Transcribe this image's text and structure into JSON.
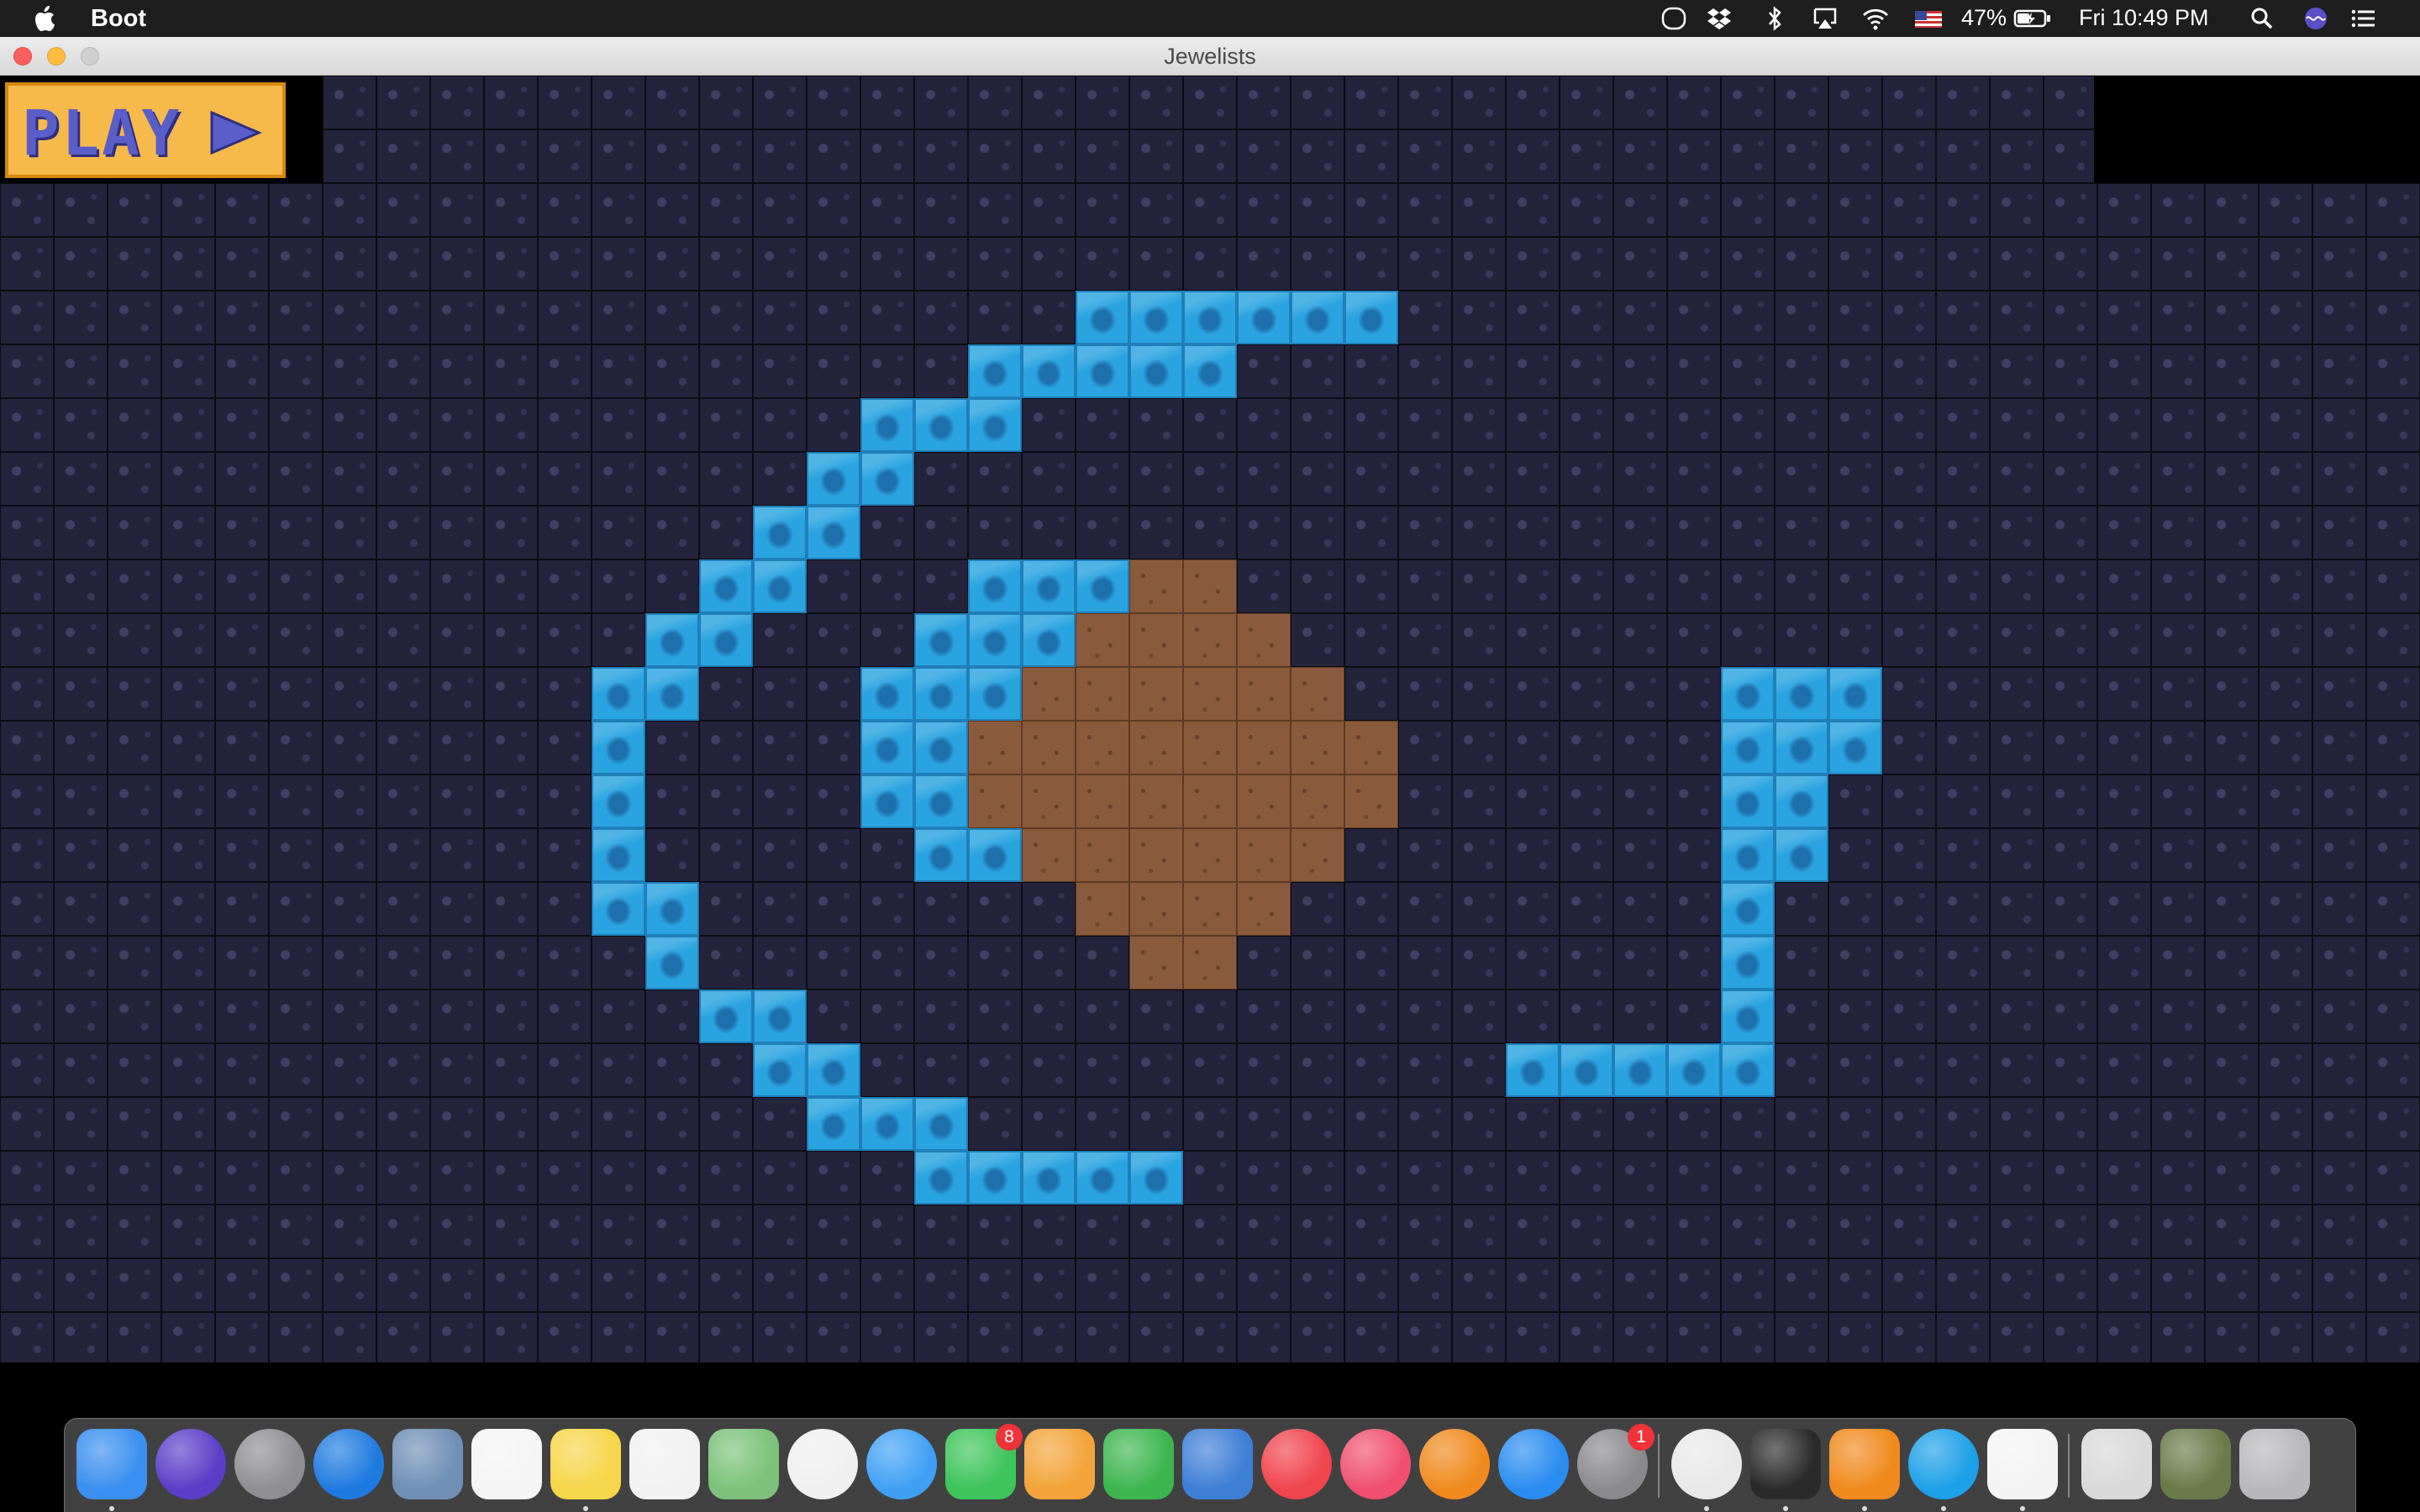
{
  "menubar": {
    "app_name": "Boot",
    "battery": "47%",
    "clock": "Fri 10:49 PM"
  },
  "window": {
    "title": "Jewelists"
  },
  "game": {
    "play_label": "PLAY",
    "water_tiles": [
      [
        4,
        20
      ],
      [
        4,
        21
      ],
      [
        4,
        22
      ],
      [
        4,
        23
      ],
      [
        4,
        24
      ],
      [
        4,
        25
      ],
      [
        5,
        18
      ],
      [
        5,
        19
      ],
      [
        5,
        20
      ],
      [
        5,
        21
      ],
      [
        5,
        22
      ],
      [
        6,
        16
      ],
      [
        6,
        17
      ],
      [
        6,
        18
      ],
      [
        7,
        15
      ],
      [
        7,
        16
      ],
      [
        8,
        14
      ],
      [
        8,
        15
      ],
      [
        9,
        13
      ],
      [
        9,
        14
      ],
      [
        9,
        18
      ],
      [
        9,
        19
      ],
      [
        9,
        20
      ],
      [
        10,
        12
      ],
      [
        10,
        13
      ],
      [
        10,
        17
      ],
      [
        10,
        18
      ],
      [
        10,
        19
      ],
      [
        11,
        11
      ],
      [
        11,
        12
      ],
      [
        11,
        16
      ],
      [
        11,
        17
      ],
      [
        11,
        18
      ],
      [
        11,
        32
      ],
      [
        11,
        33
      ],
      [
        11,
        34
      ],
      [
        12,
        11
      ],
      [
        12,
        16
      ],
      [
        12,
        17
      ],
      [
        12,
        32
      ],
      [
        12,
        33
      ],
      [
        12,
        34
      ],
      [
        13,
        11
      ],
      [
        13,
        16
      ],
      [
        13,
        17
      ],
      [
        13,
        32
      ],
      [
        13,
        33
      ],
      [
        14,
        11
      ],
      [
        14,
        17
      ],
      [
        14,
        18
      ],
      [
        14,
        32
      ],
      [
        14,
        33
      ],
      [
        15,
        11
      ],
      [
        15,
        12
      ],
      [
        15,
        32
      ],
      [
        16,
        12
      ],
      [
        16,
        32
      ],
      [
        17,
        13
      ],
      [
        17,
        14
      ],
      [
        17,
        32
      ],
      [
        18,
        14
      ],
      [
        18,
        15
      ],
      [
        18,
        28
      ],
      [
        18,
        29
      ],
      [
        18,
        30
      ],
      [
        18,
        31
      ],
      [
        18,
        32
      ],
      [
        19,
        15
      ],
      [
        19,
        16
      ],
      [
        19,
        17
      ],
      [
        20,
        17
      ],
      [
        20,
        18
      ],
      [
        20,
        19
      ],
      [
        20,
        20
      ],
      [
        20,
        21
      ]
    ],
    "dirt_tiles": [
      [
        9,
        21
      ],
      [
        9,
        22
      ],
      [
        10,
        20
      ],
      [
        10,
        21
      ],
      [
        10,
        22
      ],
      [
        10,
        23
      ],
      [
        11,
        19
      ],
      [
        11,
        20
      ],
      [
        11,
        21
      ],
      [
        11,
        22
      ],
      [
        11,
        23
      ],
      [
        11,
        24
      ],
      [
        12,
        18
      ],
      [
        12,
        19
      ],
      [
        12,
        20
      ],
      [
        12,
        21
      ],
      [
        12,
        22
      ],
      [
        12,
        23
      ],
      [
        12,
        24
      ],
      [
        12,
        25
      ],
      [
        13,
        18
      ],
      [
        13,
        19
      ],
      [
        13,
        20
      ],
      [
        13,
        21
      ],
      [
        13,
        22
      ],
      [
        13,
        23
      ],
      [
        13,
        24
      ],
      [
        13,
        25
      ],
      [
        14,
        19
      ],
      [
        14,
        20
      ],
      [
        14,
        21
      ],
      [
        14,
        22
      ],
      [
        14,
        23
      ],
      [
        14,
        24
      ],
      [
        15,
        20
      ],
      [
        15,
        21
      ],
      [
        15,
        22
      ],
      [
        15,
        23
      ],
      [
        16,
        21
      ],
      [
        16,
        22
      ]
    ]
  },
  "dock": {
    "apps": [
      {
        "name": "finder",
        "color": "#3b8ff0",
        "badge": ""
      },
      {
        "name": "siri",
        "color": "#5a3ec8",
        "badge": ""
      },
      {
        "name": "launchpad",
        "color": "#8e8e93",
        "badge": ""
      },
      {
        "name": "safari",
        "color": "#1f7ae0",
        "badge": ""
      },
      {
        "name": "mail-bird",
        "color": "#6f8fb5",
        "badge": ""
      },
      {
        "name": "calendar",
        "color": "#f5f5f5",
        "badge": ""
      },
      {
        "name": "notes",
        "color": "#f6d64a",
        "badge": ""
      },
      {
        "name": "reminders",
        "color": "#f2f2f2",
        "badge": ""
      },
      {
        "name": "maps",
        "color": "#7cc27a",
        "badge": ""
      },
      {
        "name": "photos",
        "color": "#f0f0f0",
        "badge": ""
      },
      {
        "name": "messages",
        "color": "#3fa0f5",
        "badge": ""
      },
      {
        "name": "facetime",
        "color": "#3dc45a",
        "badge": "8"
      },
      {
        "name": "pages",
        "color": "#f3a43a",
        "badge": ""
      },
      {
        "name": "numbers",
        "color": "#3eb650",
        "badge": ""
      },
      {
        "name": "keynote",
        "color": "#3e7fd6",
        "badge": ""
      },
      {
        "name": "news",
        "color": "#f0444e",
        "badge": ""
      },
      {
        "name": "music",
        "color": "#f0506e",
        "badge": ""
      },
      {
        "name": "books",
        "color": "#f08a1e",
        "badge": ""
      },
      {
        "name": "app-store",
        "color": "#2a8cf0",
        "badge": ""
      },
      {
        "name": "system-preferences",
        "color": "#8a8a8e",
        "badge": "1"
      },
      {
        "name": "chrome",
        "color": "#e8e8e8",
        "badge": ""
      },
      {
        "name": "terminal",
        "color": "#2a2a2a",
        "badge": ""
      },
      {
        "name": "sublime-text",
        "color": "#f08a1e",
        "badge": ""
      },
      {
        "name": "skype",
        "color": "#1da0e8",
        "badge": ""
      },
      {
        "name": "java",
        "color": "#f4f4f4",
        "badge": ""
      },
      {
        "name": "itunes-folder",
        "color": "#d9d9d9",
        "badge": ""
      },
      {
        "name": "image-viewer",
        "color": "#6a7a4a",
        "badge": ""
      },
      {
        "name": "trash",
        "color": "#b8b8bc",
        "badge": ""
      }
    ]
  }
}
